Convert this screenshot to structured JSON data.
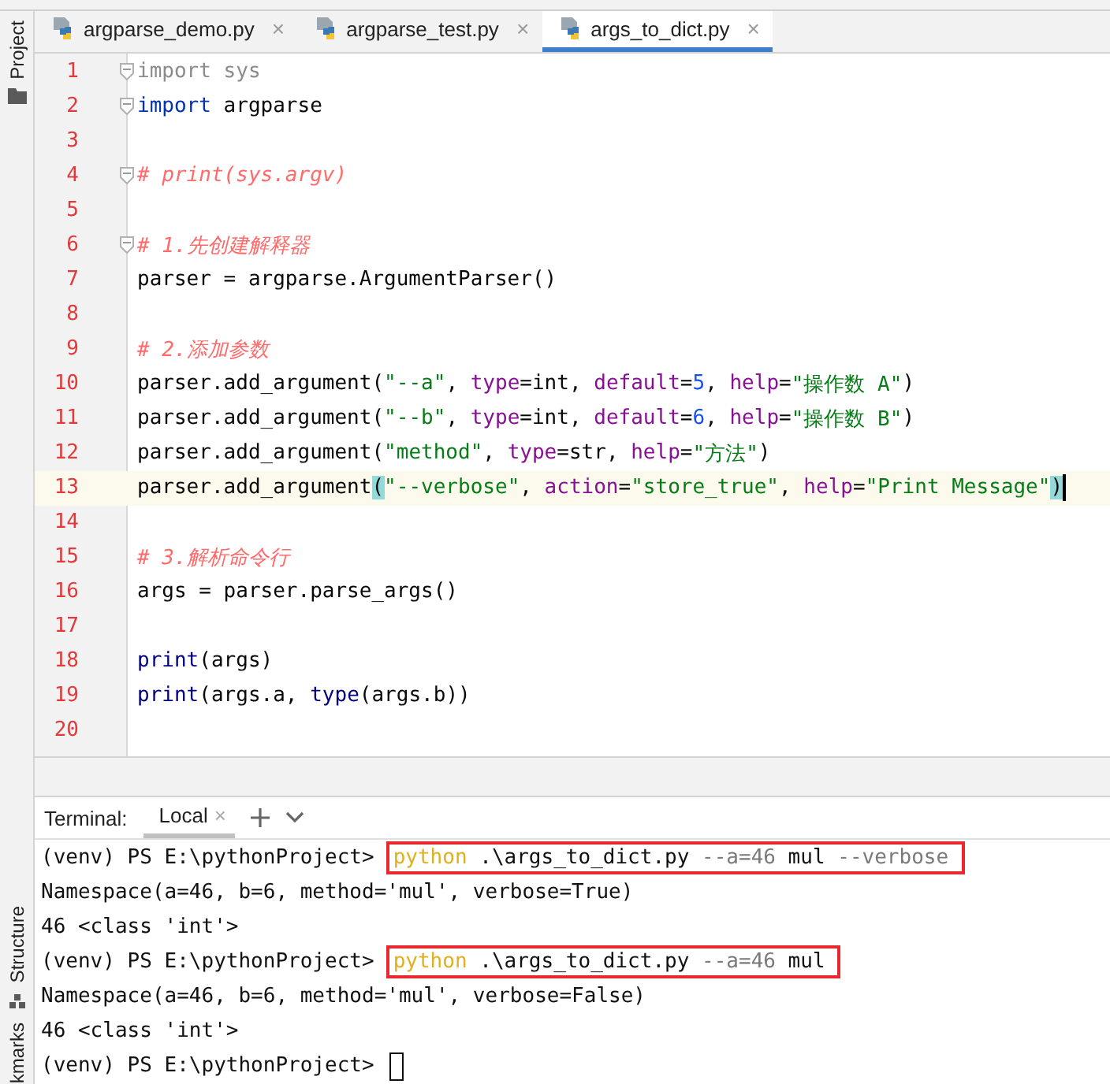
{
  "tool_strip": {
    "top": [
      {
        "label": "Project"
      }
    ],
    "bottom": [
      {
        "label": "Structure"
      },
      {
        "label": "kmarks"
      }
    ]
  },
  "tabs": [
    {
      "label": "argparse_demo.py",
      "selected": false,
      "close": "×"
    },
    {
      "label": "argparse_test.py",
      "selected": false,
      "close": "×"
    },
    {
      "label": "args_to_dict.py",
      "selected": true,
      "close": "×"
    }
  ],
  "editor": {
    "lines": [
      {
        "number": "1",
        "fold": true,
        "current": false,
        "tokens": [
          {
            "kind": "unused",
            "text": "import sys"
          }
        ]
      },
      {
        "number": "2",
        "fold": true,
        "current": false,
        "tokens": [
          {
            "kind": "keyword",
            "text": "import"
          },
          {
            "kind": "plain",
            "text": " argparse"
          }
        ]
      },
      {
        "number": "3",
        "fold": false,
        "current": false
      },
      {
        "number": "4",
        "fold": true,
        "current": false,
        "tokens": [
          {
            "kind": "comment",
            "text": "# print(sys.argv)"
          }
        ]
      },
      {
        "number": "5",
        "fold": false,
        "current": false
      },
      {
        "number": "6",
        "fold": true,
        "current": false,
        "tokens": [
          {
            "kind": "comment",
            "text": "# 1.先创建解释器"
          }
        ]
      },
      {
        "number": "7",
        "fold": false,
        "current": false,
        "tokens": [
          {
            "kind": "plain",
            "text": "parser = argparse.ArgumentParser()"
          }
        ]
      },
      {
        "number": "8",
        "fold": false,
        "current": false
      },
      {
        "number": "9",
        "fold": false,
        "current": false,
        "tokens": [
          {
            "kind": "comment",
            "text": "# 2.添加参数"
          }
        ]
      },
      {
        "number": "10",
        "fold": false,
        "current": false,
        "tokens": [
          {
            "kind": "plain",
            "text": "parser.add_argument("
          },
          {
            "kind": "string",
            "text": "\"--a\""
          },
          {
            "kind": "plain",
            "text": ", "
          },
          {
            "kind": "param",
            "text": "type"
          },
          {
            "kind": "plain",
            "text": "=int, "
          },
          {
            "kind": "param",
            "text": "default"
          },
          {
            "kind": "plain",
            "text": "="
          },
          {
            "kind": "number",
            "text": "5"
          },
          {
            "kind": "plain",
            "text": ", "
          },
          {
            "kind": "param",
            "text": "help"
          },
          {
            "kind": "plain",
            "text": "="
          },
          {
            "kind": "string",
            "text": "\"操作数 A\""
          },
          {
            "kind": "plain",
            "text": ")"
          }
        ]
      },
      {
        "number": "11",
        "fold": false,
        "current": false,
        "tokens": [
          {
            "kind": "plain",
            "text": "parser.add_argument("
          },
          {
            "kind": "string",
            "text": "\"--b\""
          },
          {
            "kind": "plain",
            "text": ", "
          },
          {
            "kind": "param",
            "text": "type"
          },
          {
            "kind": "plain",
            "text": "=int, "
          },
          {
            "kind": "param",
            "text": "default"
          },
          {
            "kind": "plain",
            "text": "="
          },
          {
            "kind": "number",
            "text": "6"
          },
          {
            "kind": "plain",
            "text": ", "
          },
          {
            "kind": "param",
            "text": "help"
          },
          {
            "kind": "plain",
            "text": "="
          },
          {
            "kind": "string",
            "text": "\"操作数 B\""
          },
          {
            "kind": "plain",
            "text": ")"
          }
        ]
      },
      {
        "number": "12",
        "fold": false,
        "current": false,
        "tokens": [
          {
            "kind": "plain",
            "text": "parser.add_argument("
          },
          {
            "kind": "string",
            "text": "\"method\""
          },
          {
            "kind": "plain",
            "text": ", "
          },
          {
            "kind": "param",
            "text": "type"
          },
          {
            "kind": "plain",
            "text": "=str, "
          },
          {
            "kind": "param",
            "text": "help"
          },
          {
            "kind": "plain",
            "text": "="
          },
          {
            "kind": "string",
            "text": "\"方法\""
          },
          {
            "kind": "plain",
            "text": ")"
          }
        ]
      },
      {
        "number": "13",
        "fold": false,
        "current": true,
        "tokens": [
          {
            "kind": "plain",
            "text": "parser.add_argument"
          },
          {
            "kind": "brace",
            "text": "("
          },
          {
            "kind": "string",
            "text": "\"--verbose\""
          },
          {
            "kind": "plain",
            "text": ", "
          },
          {
            "kind": "param",
            "text": "action"
          },
          {
            "kind": "plain",
            "text": "="
          },
          {
            "kind": "string",
            "text": "\"store_true\""
          },
          {
            "kind": "plain",
            "text": ", "
          },
          {
            "kind": "param",
            "text": "help"
          },
          {
            "kind": "plain",
            "text": "="
          },
          {
            "kind": "string",
            "text": "\"Print Message\""
          },
          {
            "kind": "brace",
            "text": ")"
          }
        ]
      },
      {
        "number": "14",
        "fold": false,
        "current": false
      },
      {
        "number": "15",
        "fold": false,
        "current": false,
        "tokens": [
          {
            "kind": "comment",
            "text": "# 3.解析命令行"
          }
        ]
      },
      {
        "number": "16",
        "fold": false,
        "current": false,
        "tokens": [
          {
            "kind": "plain",
            "text": "args = parser.parse_args()"
          }
        ]
      },
      {
        "number": "17",
        "fold": false,
        "current": false
      },
      {
        "number": "18",
        "fold": false,
        "current": false,
        "tokens": [
          {
            "kind": "builtin",
            "text": "print"
          },
          {
            "kind": "plain",
            "text": "(args)"
          }
        ]
      },
      {
        "number": "19",
        "fold": false,
        "current": false,
        "tokens": [
          {
            "kind": "builtin",
            "text": "print"
          },
          {
            "kind": "plain",
            "text": "(args.a, "
          },
          {
            "kind": "builtin",
            "text": "type"
          },
          {
            "kind": "plain",
            "text": "(args.b))"
          }
        ]
      },
      {
        "number": "20",
        "fold": false,
        "current": false
      }
    ]
  },
  "terminal": {
    "title": "Terminal:",
    "tabs": [
      {
        "label": "Local",
        "selected": true,
        "close": "×"
      }
    ],
    "lines": [
      {
        "kind": "prompt",
        "prompt": "(venv) PS E:\\pythonProject>",
        "boxed": true,
        "cursor": false,
        "tokens": [
          {
            "kind": "exe",
            "text": "python"
          },
          {
            "kind": "plain",
            "text": " .\\args_to_dict.py "
          },
          {
            "kind": "option",
            "text": "--a=46"
          },
          {
            "kind": "plain",
            "text": " mul "
          },
          {
            "kind": "option",
            "text": "--verbose"
          }
        ]
      },
      {
        "kind": "output",
        "text": "Namespace(a=46, b=6, method='mul', verbose=True)"
      },
      {
        "kind": "output",
        "text": "46 <class 'int'>"
      },
      {
        "kind": "prompt",
        "prompt": "(venv) PS E:\\pythonProject>",
        "boxed": true,
        "cursor": false,
        "tokens": [
          {
            "kind": "exe",
            "text": "python"
          },
          {
            "kind": "plain",
            "text": " .\\args_to_dict.py "
          },
          {
            "kind": "option",
            "text": "--a=46"
          },
          {
            "kind": "plain",
            "text": " mul"
          }
        ]
      },
      {
        "kind": "output",
        "text": "Namespace(a=46, b=6, method='mul', verbose=False)"
      },
      {
        "kind": "output",
        "text": "46 <class 'int'>"
      },
      {
        "kind": "prompt",
        "prompt": "(venv) PS E:\\pythonProject>",
        "boxed": false,
        "cursor": true
      }
    ]
  }
}
